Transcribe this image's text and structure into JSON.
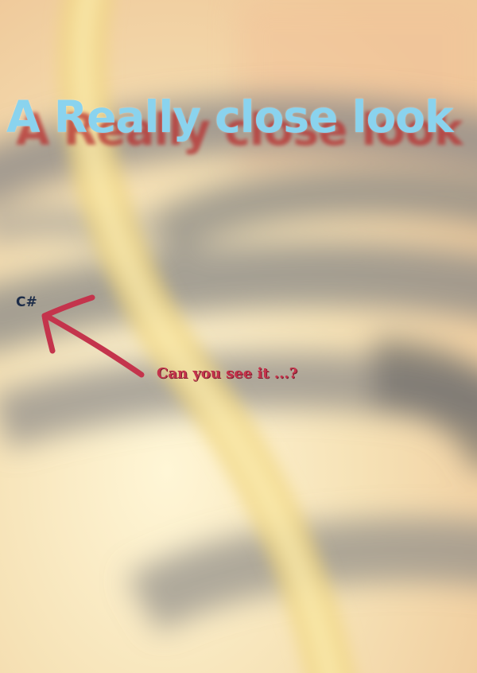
{
  "poster": {
    "title": "A Really close look",
    "label": "C#",
    "caption": "Can you see it ...?"
  },
  "colors": {
    "title": "#8ad3ee",
    "title_shadow": "#b83030",
    "label": "#1c2c48",
    "arrow": "#c4344c",
    "caption": "#c4344c",
    "background": "#f4dcb4"
  },
  "icons": {
    "pointer": "hand-drawn-arrow-icon"
  }
}
